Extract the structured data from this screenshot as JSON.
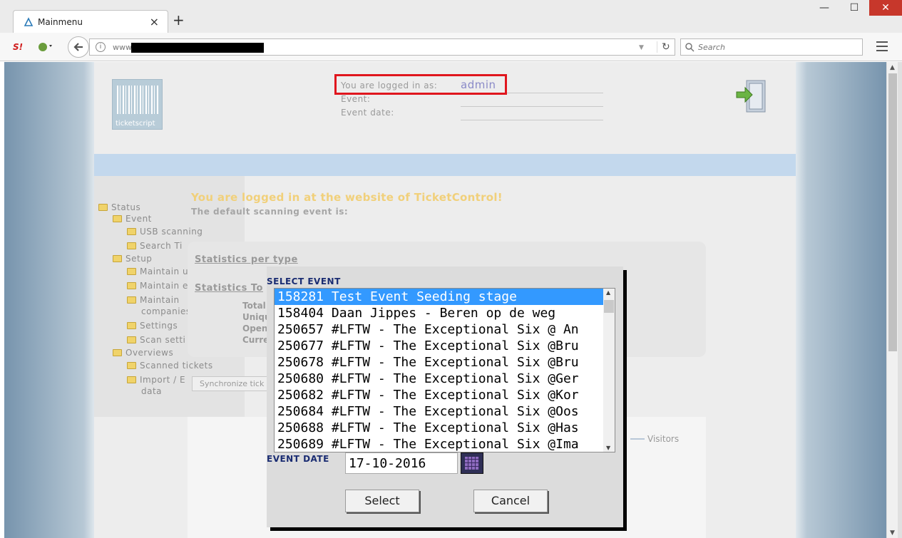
{
  "browser": {
    "tab_title": "Mainmenu",
    "new_tab": "+",
    "url_prefix": "www",
    "search_placeholder": "Search",
    "ext_label": "S!"
  },
  "header": {
    "logo_text": "ticketscript",
    "logged_in_label": "You are logged in as:",
    "user": "admin",
    "event_label": "Event:",
    "event_date_label": "Event date:"
  },
  "sidebar": {
    "items": [
      {
        "label": "Status",
        "level": 0
      },
      {
        "label": "Event",
        "level": 1
      },
      {
        "label": "USB scanning",
        "level": 2
      },
      {
        "label": "Search Ti",
        "level": 2
      },
      {
        "label": "Setup",
        "level": 1
      },
      {
        "label": "Maintain u",
        "level": 2
      },
      {
        "label": "Maintain e",
        "level": 2
      },
      {
        "label": "Maintain",
        "level": 2
      },
      {
        "label": "companies",
        "level": 2
      },
      {
        "label": "Settings",
        "level": 2
      },
      {
        "label": "Scan setti",
        "level": 2
      },
      {
        "label": "Overviews",
        "level": 1
      },
      {
        "label": "Scanned tickets",
        "level": 2
      },
      {
        "label": "Import / E",
        "level": 2
      },
      {
        "label": "data",
        "level": 2
      }
    ]
  },
  "main": {
    "welcome": "You are logged in at the website of TicketControl!",
    "default_scan": "The default scanning event is:",
    "stats_per_type": "Statistics per type",
    "stats_total": "Statistics To",
    "stat_labels": [
      "Total",
      "Uniqu",
      "Open",
      "Curre"
    ],
    "sync_button": "Synchronize tick",
    "legend_visitors": "Visitors"
  },
  "dialog": {
    "select_label": "SELECT EVENT",
    "events": [
      "158281 Test Event Seeding stage",
      "158404 Daan Jippes - Beren op de weg",
      "250657 #LFTW - The Exceptional Six @ An",
      "250677 #LFTW - The Exceptional Six @Bru",
      "250678 #LFTW - The Exceptional Six @Bru",
      "250680 #LFTW - The Exceptional Six @Ger",
      "250682 #LFTW - The Exceptional Six @Kor",
      "250684 #LFTW - The Exceptional Six @Oos",
      "250688 #LFTW - The Exceptional Six @Has",
      "250689 #LFTW - The Exceptional Six @Ima"
    ],
    "selected_index": 0,
    "date_label": "EVENT DATE",
    "date_value": "17-10-2016",
    "select_button": "Select",
    "cancel_button": "Cancel"
  },
  "colors": {
    "accent_red": "#e0161e",
    "selection_blue": "#3399ff",
    "label_navy": "#1a2c72",
    "welcome_yellow": "#f1d07a"
  }
}
